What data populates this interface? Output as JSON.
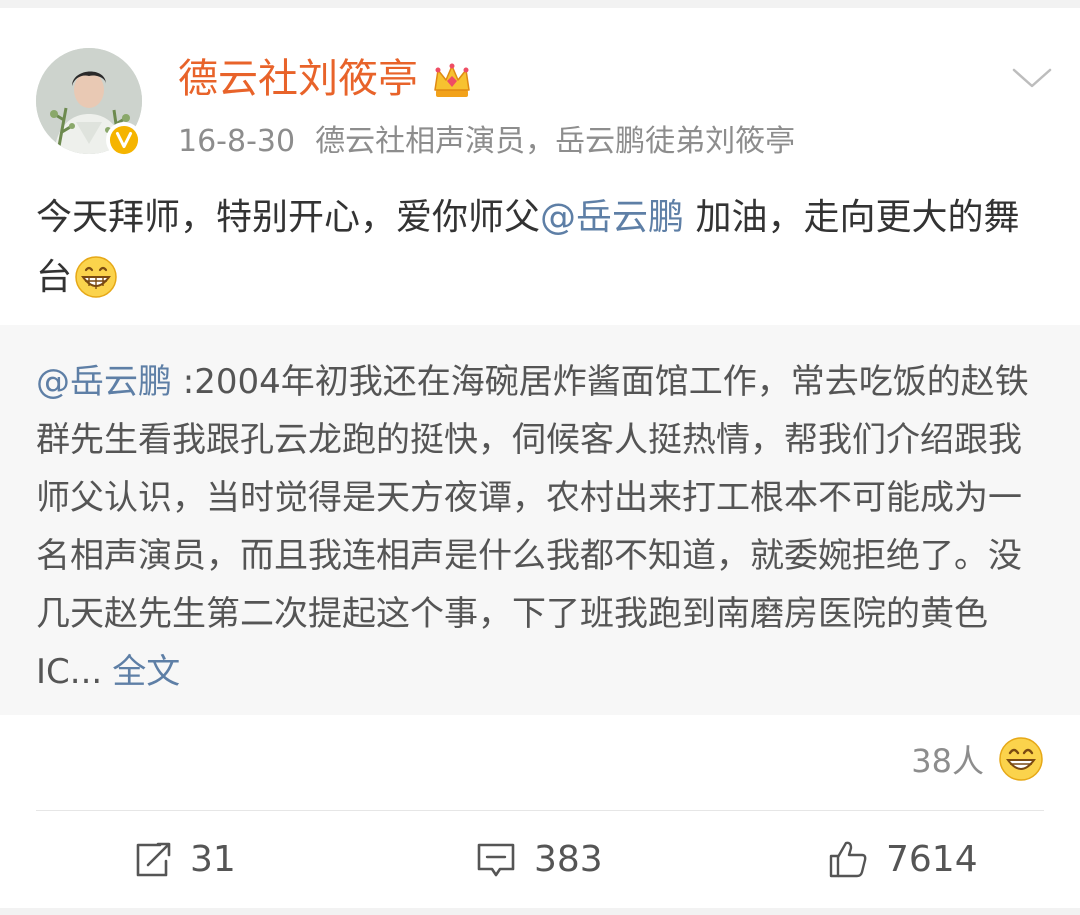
{
  "post": {
    "author": "德云社刘筱亭",
    "date": "16-8-30",
    "verified_desc": "德云社相声演员，岳云鹏徒弟刘筱亭",
    "text_before_mention": "今天拜师，特别开心，爱你师父",
    "mention": "@岳云鹏",
    "text_after_mention": " 加油，走向更大的舞台"
  },
  "retweet": {
    "mention": "@岳云鹏",
    "text": " :2004年初我还在海碗居炸酱面馆工作，常去吃饭的赵铁群先生看我跟孔云龙跑的挺快，伺候客人挺热情，帮我们介绍跟我师父认识，当时觉得是天方夜谭，农村出来打工根本不可能成为一名相声演员，而且我连相声是什么我都不知道，就委婉拒绝了。没几天赵先生第二次提起这个事，下了班我跑到南磨房医院的黄色IC...",
    "full_text_link": "全文"
  },
  "reactions": {
    "count": "38人"
  },
  "actions": {
    "repost": "31",
    "comment": "383",
    "like": "7614"
  },
  "colors": {
    "username": "#e8632a",
    "link": "#5e7fa6",
    "muted": "#8d8d8d",
    "verified_badge": "#f5b400"
  },
  "icons": [
    "avatar-photo",
    "verified-badge-icon",
    "crown-icon",
    "chevron-down-icon",
    "grin-emoji",
    "reaction-emoji",
    "repost-icon",
    "comment-icon",
    "like-icon"
  ]
}
